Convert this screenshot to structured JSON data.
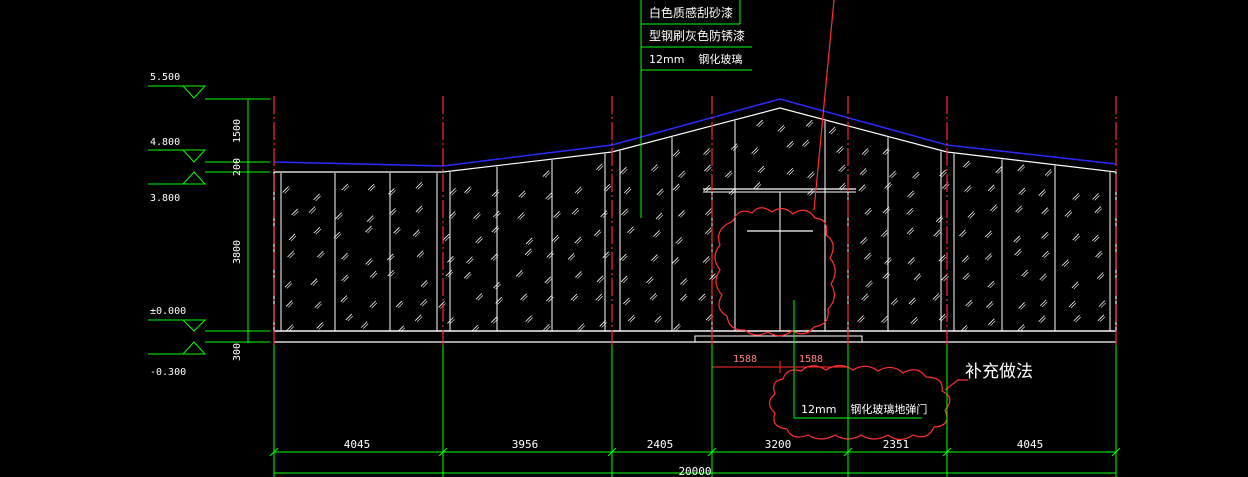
{
  "colors": {
    "background": "#000000",
    "dimension_green": "#00ff00",
    "grid_red": "#ff2a2a",
    "outline_white": "#ffffff",
    "roof_blue": "#2a2aff",
    "revision_red": "#ff3030",
    "dim_text": "#ffffff",
    "revision_text": "#ff8080"
  },
  "elevation_labels": {
    "top": "5.500",
    "eave_upper": "4.800",
    "eave_lower": "3.800",
    "ground": "±0.000",
    "base": "-0.300"
  },
  "vertical_dims": {
    "d1": "1500",
    "d2": "200",
    "d3": "3800",
    "d4": "300"
  },
  "callout_notes": [
    "白色质感刮砂漆",
    "型钢刷灰色防锈漆",
    "12mm    钢化玻璃"
  ],
  "door_dims": {
    "left": "1588",
    "right": "1588"
  },
  "revision": {
    "title": "补充做法",
    "door_note": "12mm    钢化玻璃地弹门"
  },
  "bottom_dims": [
    "4045",
    "3956",
    "2405",
    "3200",
    "2351",
    "4045"
  ],
  "overall_dim": "20000"
}
